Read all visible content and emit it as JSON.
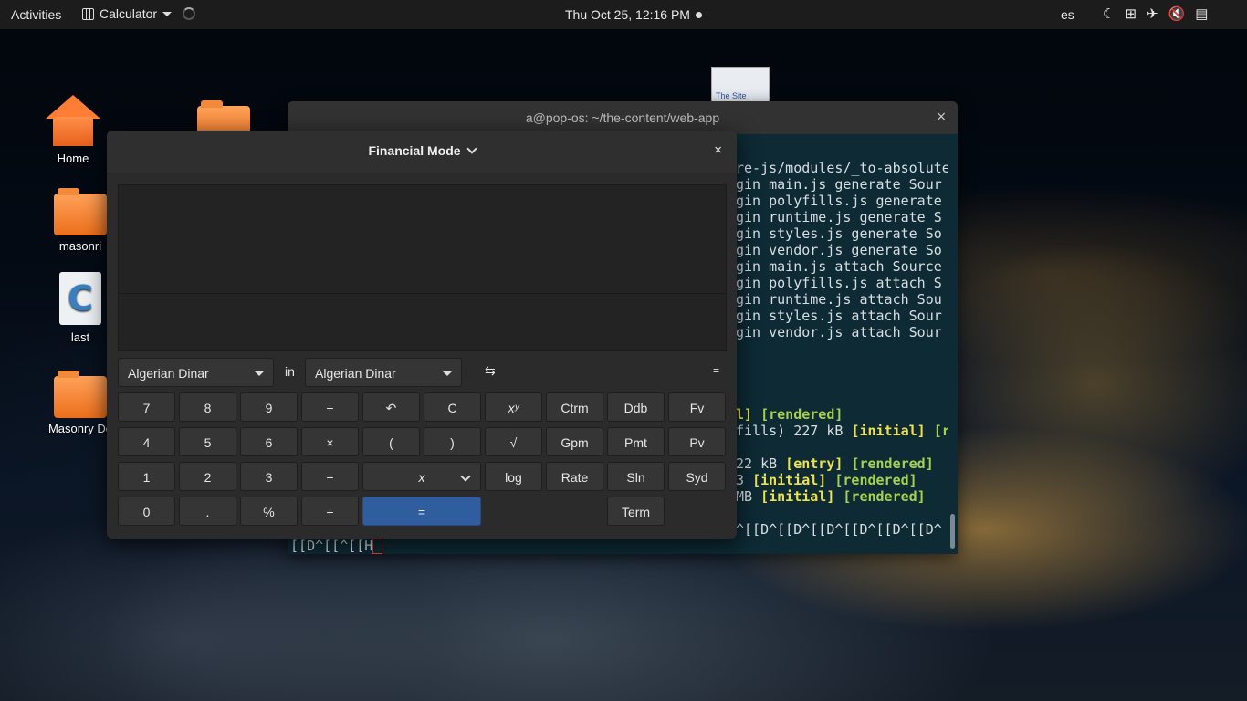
{
  "topbar": {
    "activities": "Activities",
    "app_name": "Calculator",
    "datetime": "Thu Oct 25, 12:16 PM",
    "language": "es",
    "tray_icons": [
      "night-light-icon",
      "network-icon",
      "airplane-icon",
      "volume-muted-icon",
      "clipboard-icon"
    ]
  },
  "desktop": {
    "icons": [
      {
        "name": "Home",
        "type": "home"
      },
      {
        "name": "masonri",
        "type": "folder"
      },
      {
        "name": "last",
        "type": "c-file"
      },
      {
        "name": "Masonry Do",
        "type": "folder"
      }
    ],
    "thumbnail_label": "The Site"
  },
  "terminal": {
    "title": "a@pop-os: ~/the-content/web-app",
    "close": "×",
    "lines": [
      {
        "text": "re-js/modules/_to-absolute"
      },
      {
        "text": "gin main.js generate Sour"
      },
      {
        "text": "gin polyfills.js generate"
      },
      {
        "text": "gin runtime.js generate S"
      },
      {
        "text": "gin styles.js generate So"
      },
      {
        "text": "gin vendor.js generate So"
      },
      {
        "text": "gin main.js attach Source"
      },
      {
        "text": "gin polyfills.js attach S"
      },
      {
        "text": "gin runtime.js attach Sou"
      },
      {
        "text": "gin styles.js attach Sour"
      },
      {
        "text": "gin vendor.js attach Sour"
      }
    ],
    "colored": [
      {
        "pre": "",
        "a": "l]",
        "b": "[rendered]",
        "post": ""
      },
      {
        "pre": "fills) 227 kB ",
        "a": "[initial]",
        "b": "[r",
        "post": ""
      },
      {
        "pre": "22 kB ",
        "a": "[entry]",
        "b": "[rendered]",
        "post": ""
      },
      {
        "pre": "3 ",
        "a": "[initial]",
        "b": "[rendered]",
        "post": ""
      },
      {
        "pre": "MB ",
        "a": "[initial]",
        "b": "[rendered]",
        "post": ""
      }
    ],
    "escape_line": "^[[D^[[D^[[D^[[D^[[D^[[D^",
    "prompt_line": ".[[D^[[^[[H"
  },
  "calculator": {
    "mode": "Financial Mode",
    "close": "×",
    "from_currency": "Algerian Dinar",
    "in_label": "in",
    "to_currency": "Algerian Dinar",
    "swap": "⇆",
    "equals_small": "=",
    "buttons": {
      "b7": "7",
      "b8": "8",
      "b9": "9",
      "div": "÷",
      "undo": "↶",
      "clear": "C",
      "pow": "xʸ",
      "ctrm": "Ctrm",
      "ddb": "Ddb",
      "fv": "Fv",
      "b4": "4",
      "b5": "5",
      "b6": "6",
      "mul": "×",
      "lparen": "(",
      "rparen": ")",
      "sqrt": "√",
      "gpm": "Gpm",
      "pmt": "Pmt",
      "pv": "Pv",
      "b1": "1",
      "b2": "2",
      "b3": "3",
      "minus": "−",
      "x": "x",
      "log": "log",
      "rate": "Rate",
      "sln": "Sln",
      "syd": "Syd",
      "b0": "0",
      "dot": ".",
      "pct": "%",
      "plus": "+",
      "eq": "=",
      "term": "Term"
    }
  }
}
